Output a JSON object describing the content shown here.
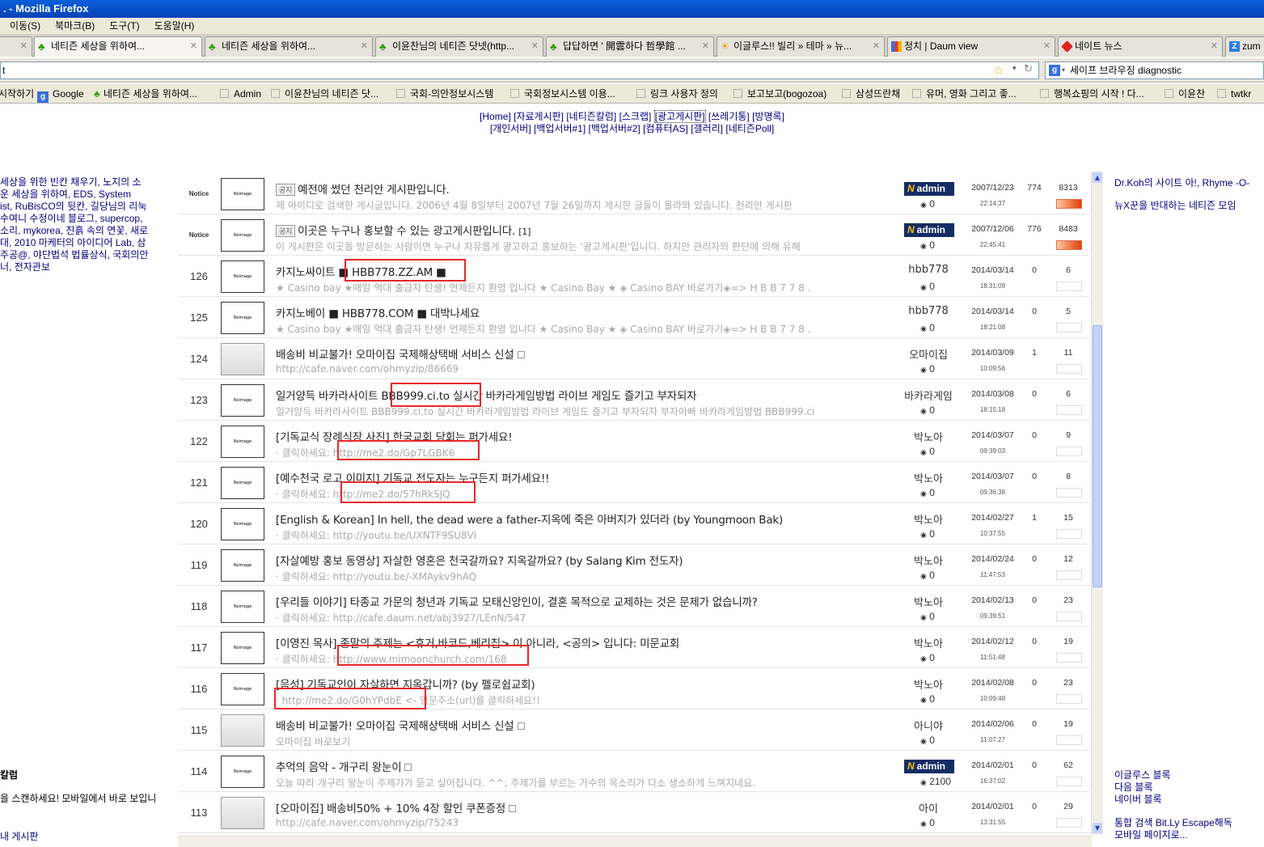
{
  "window": {
    "title": ". - Mozilla Firefox"
  },
  "menu": [
    "이동(S)",
    "북마크(B)",
    "도구(T)",
    "도움말(H)"
  ],
  "tabs": [
    {
      "label": "네티즌 세상을 위하여..."
    },
    {
      "label": "네티즌 세상을 위하여..."
    },
    {
      "label": "이윤찬님의 네티즌 닷넷(http..."
    },
    {
      "label": "답답하면 ' 開雲하다 哲學館 ..."
    },
    {
      "label": "이글루스!! 빌리 » 테마 » 뉴..."
    },
    {
      "label": "정치 | Daum view"
    },
    {
      "label": "네이트 뉴스"
    },
    {
      "label": "zum"
    }
  ],
  "address": {
    "value": "t"
  },
  "search": {
    "value": "세이프 브라우징 diagnostic"
  },
  "bookmarks": [
    "시작하기",
    "Google",
    "네티즌 세상을 위하여...",
    "Admin",
    "이윤찬님의 네티즌 닷...",
    "국회-의안정보시스템",
    "국회정보시스템 이용...",
    "링크 사용자 정의",
    "보고보고(bogozoa)",
    "삼성뜨란채",
    "유머, 영화 그리고 좋...",
    "행복쇼핑의 시작 ! 다...",
    "이윤찬",
    "twtkr"
  ],
  "nav": {
    "line1": [
      "[Home]",
      "[자료게시판]",
      "[네티즌칼럼]",
      "[스크랩]",
      "[광고게시판]",
      "[쓰레기통]",
      "[방명록]"
    ],
    "line2": [
      "[개인서버]",
      "[백업서버#1]",
      "[백업서버#2]",
      "[컴퓨터AS]",
      "[갤러리]",
      "[네티즌Poll]"
    ]
  },
  "left": {
    "lines": [
      "세상을 위한 빈칸 채우기, 노지의 소",
      "운 세상을 위하여, EDS, System",
      "ist, RuBisCO의 뒷칸, 길당님의 리눅",
      "수여니 수정이네 블로그, supercop,",
      "소리, mykorea, 진흙 속의 연꽃, 새로",
      "대, 2010 마케터의 아이디어 Lab, 삼",
      "주공@, 야단법석 법률상식, 국회의안",
      "너, 전자관보"
    ],
    "column_title": "칼럼",
    "qr_text": "을 스캔하세요! 모바일에서 바로 보입니",
    "bottom": "내 게시판"
  },
  "right": {
    "top": [
      "Dr.Koh의 사이트 아!, Rhyme -O-",
      "뉴X꾼을 반대하는 네티즌 모임"
    ],
    "bottom": [
      "이글루스 블록",
      "다음 블록",
      "네이버 블록"
    ],
    "footer": [
      "통합 검색 Bit.Ly Escape해독",
      "모바일 페이지로..."
    ]
  },
  "posts": [
    {
      "num": "Notice",
      "notice": true,
      "title": "예전에 썼던 천리안 게시판입니다.",
      "desc": "제 아이디로 검색한 게시글입니다. 2006년 4월 8일부터 2007년 7월 26일까지 게시한 글들이 올라와 있습니다. 천리안 게시판",
      "author": "admin",
      "admin": true,
      "votes": "0",
      "date": "2007/12/23",
      "time": "22:14:37",
      "comments": "774",
      "hits": "8313",
      "hot": true,
      "label": "공지"
    },
    {
      "num": "Notice",
      "notice": true,
      "title": "이곳은 누구나 홍보할 수 있는 광고게시판입니다.",
      "title_suffix": "[1]",
      "desc": "이 게시판은 이곳을 방문하는 사람이면 누구나 자유롭게 광고하고 홍보하는 '광고게시판'입니다. 하지만 관리자의 판단에 의해 유해",
      "author": "admin",
      "admin": true,
      "votes": "0",
      "date": "2007/12/06",
      "time": "22:45:41",
      "comments": "776",
      "hits": "8483",
      "hot": true,
      "label": "공지"
    },
    {
      "num": "126",
      "title": "카지노싸이트 ■ HBB778.ZZ.AM ■",
      "desc": "★ Casino bay ★매일  억대 출금자 탄생! 언제든지 환영 입니다 ★ Casino Bay ★  ◈ Casino BAY 바로가기◈=> H B B 7 7 8 .",
      "author": "hbb778",
      "votes": "0",
      "date": "2014/03/14",
      "time": "18:31:09",
      "comments": "0",
      "hits": "6"
    },
    {
      "num": "125",
      "title": "카지노베이 ■ HBB778.COM ■ 대박나세요",
      "desc": "★ Casino bay ★매일  억대 출금자 탄생! 언제든지 환영 입니다 ★ Casino Bay ★  ◈ Casino BAY 바로가기◈=> H B B 7 7 8 .",
      "author": "hbb778",
      "votes": "0",
      "date": "2014/03/14",
      "time": "18:21:08",
      "comments": "0",
      "hits": "5"
    },
    {
      "num": "124",
      "title": "배송비 비교불가! 오마이집 국제해상택배 서비스 신설",
      "desc": "http://cafe.naver.com/ohmyzip/86669",
      "author": "오마이집",
      "votes": "0",
      "date": "2014/03/09",
      "time": "10:09:56",
      "comments": "1",
      "hits": "11",
      "img": true
    },
    {
      "num": "123",
      "title": "일거양득 바카라사이트 BBB999.ci.to 실시간 바카라게임방법 라이브 게임도 즐기고 부자되자",
      "desc": "일거양득 바카라사이트 BBB999.ci.to 실시간 바카라게임방법 라이브 게임도 즐기고 부자되자 부자아빠 바카라게임방법 BBB999.ci",
      "author": "바카라게임",
      "votes": "0",
      "date": "2014/03/08",
      "time": "18:15:18",
      "comments": "0",
      "hits": "6"
    },
    {
      "num": "122",
      "title": "[기독교식 장례식장 사진] 한국교회 당회는 퍼가세요!",
      "desc": "· 클릭하세요: http://me2.do/Gp7LGBK6",
      "author": "박노아",
      "votes": "0",
      "date": "2014/03/07",
      "time": "09:39:03",
      "comments": "0",
      "hits": "9"
    },
    {
      "num": "121",
      "title": "[예수천국 로고 이미지] 기독교 전도자는 누구든지 퍼가세요!!",
      "desc": "· 클릭하세요: http://me2.do/57hRkSJQ",
      "author": "박노아",
      "votes": "0",
      "date": "2014/03/07",
      "time": "09:36:38",
      "comments": "0",
      "hits": "8"
    },
    {
      "num": "120",
      "title": "[English & Korean] In hell, the dead were a father-지옥에 죽은 아버지가 있더라 (by Youngmoon Bak)",
      "desc": "· 클릭하세요: http://youtu.be/UXNTF9SU8Vl",
      "author": "박노아",
      "votes": "0",
      "date": "2014/02/27",
      "time": "10:37:55",
      "comments": "1",
      "hits": "15"
    },
    {
      "num": "119",
      "title": "[자살예방 홍보 동영상] 자살한 영혼은 천국갈까요? 지옥갈까요? (by Salang Kim 전도자)",
      "desc": "· 클릭하세요: http://youtu.be/-XMAykv9hAQ",
      "author": "박노아",
      "votes": "0",
      "date": "2014/02/24",
      "time": "11:47:53",
      "comments": "0",
      "hits": "12"
    },
    {
      "num": "118",
      "title": "[우리들 이야기] 타종교 가문의 청년과 기독교 모태신앙인이, 결혼 목적으로 교제하는 것은 문제가 없습니까?",
      "desc": "· 클릭하세요: http://cafe.daum.net/abj3927/LEnN/547",
      "author": "박노아",
      "votes": "0",
      "date": "2014/02/13",
      "time": "09:39:51",
      "comments": "0",
      "hits": "23"
    },
    {
      "num": "117",
      "title": "[이영진 목사] 종말의 주제는 <휴거,바코드,베리칩> 이 아니라, <공의> 입니다: 미문교회",
      "desc": "· 클릭하세요: http://www.mimoonchurch.com/168",
      "author": "박노아",
      "votes": "0",
      "date": "2014/02/12",
      "time": "11:51:48",
      "comments": "0",
      "hits": "19"
    },
    {
      "num": "116",
      "title": "[음성] 기독교인이 자살하면 지옥갑니까? (by 펠로쉽교회)",
      "desc": "· http://me2.do/G0hYPdbE <- 영문주소(url)를 클릭하세요!!",
      "author": "박노아",
      "votes": "0",
      "date": "2014/02/08",
      "time": "10:09:48",
      "comments": "0",
      "hits": "23"
    },
    {
      "num": "115",
      "title": "배송비 비교불가! 오마이집 국제해상택배 서비스 신설",
      "desc": "오마이집 바로보기",
      "author": "아니야",
      "votes": "0",
      "date": "2014/02/06",
      "time": "11:07:27",
      "comments": "0",
      "hits": "19",
      "img": true
    },
    {
      "num": "114",
      "title": "추억의 음악 - 개구리 왕눈이",
      "desc": "오늘 따라 개구리 왕눈이 주제가가 듣고 싶어집니다. ^^; 주제가를 부르는 가수의 목소리가 다소 생소하게 느껴지네요.",
      "author": "admin",
      "admin": true,
      "votes": "2100",
      "date": "2014/02/01",
      "time": "16:37:02",
      "comments": "0",
      "hits": "62"
    },
    {
      "num": "113",
      "title": "[오마이집] 배송비50% + 10% 4장 할인 쿠폰증정",
      "desc": "http://cafe.naver.com/ohmyzip/75243",
      "author": "아이",
      "votes": "0",
      "date": "2014/02/01",
      "time": "13:31:55",
      "comments": "0",
      "hits": "29",
      "img": true
    }
  ],
  "thumb_text": "Noimage"
}
